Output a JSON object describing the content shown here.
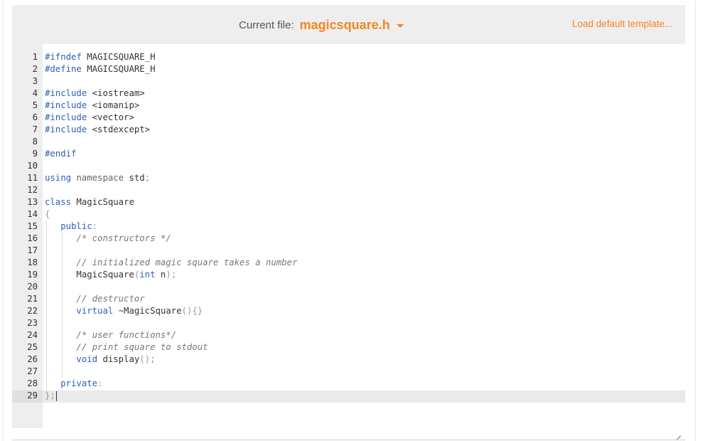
{
  "header": {
    "current_file_label": "Current file:",
    "current_file": "magicsquare.h",
    "load_template_label": "Load default template...",
    "accent_color": "#f5861f"
  },
  "editor": {
    "active_line": 29,
    "lines": [
      {
        "n": "1",
        "tokens": [
          {
            "t": "#ifndef",
            "c": "pre"
          },
          {
            "t": " MAGICSQUARE_H",
            "c": "id"
          }
        ]
      },
      {
        "n": "2",
        "tokens": [
          {
            "t": "#define",
            "c": "pre"
          },
          {
            "t": " MAGICSQUARE_H",
            "c": "id"
          }
        ]
      },
      {
        "n": "3",
        "tokens": []
      },
      {
        "n": "4",
        "tokens": [
          {
            "t": "#include",
            "c": "pre"
          },
          {
            "t": " <iostream>",
            "c": "id"
          }
        ]
      },
      {
        "n": "5",
        "tokens": [
          {
            "t": "#include",
            "c": "pre"
          },
          {
            "t": " <iomanip>",
            "c": "id"
          }
        ]
      },
      {
        "n": "6",
        "tokens": [
          {
            "t": "#include",
            "c": "pre"
          },
          {
            "t": " <vector>",
            "c": "id"
          }
        ]
      },
      {
        "n": "7",
        "tokens": [
          {
            "t": "#include",
            "c": "pre"
          },
          {
            "t": " <stdexcept>",
            "c": "id"
          }
        ]
      },
      {
        "n": "8",
        "tokens": []
      },
      {
        "n": "9",
        "tokens": [
          {
            "t": "#endif",
            "c": "pre"
          }
        ]
      },
      {
        "n": "10",
        "tokens": []
      },
      {
        "n": "11",
        "tokens": [
          {
            "t": "using",
            "c": "kw"
          },
          {
            "t": " ",
            "c": "id"
          },
          {
            "t": "namespace",
            "c": "ns"
          },
          {
            "t": " std",
            "c": "id"
          },
          {
            "t": ";",
            "c": "pn"
          }
        ]
      },
      {
        "n": "12",
        "tokens": []
      },
      {
        "n": "13",
        "tokens": [
          {
            "t": "class",
            "c": "kw"
          },
          {
            "t": " MagicSquare",
            "c": "id"
          }
        ]
      },
      {
        "n": "14",
        "tokens": [
          {
            "t": "{",
            "c": "pn"
          }
        ]
      },
      {
        "n": "15",
        "indent": 1,
        "tokens": [
          {
            "t": "   ",
            "c": "id"
          },
          {
            "t": "public",
            "c": "kw"
          },
          {
            "t": ":",
            "c": "pn"
          }
        ]
      },
      {
        "n": "16",
        "indent": 2,
        "tokens": [
          {
            "t": "      ",
            "c": "id"
          },
          {
            "t": "/* constructors */",
            "c": "cm"
          }
        ]
      },
      {
        "n": "17",
        "indent": 2,
        "tokens": []
      },
      {
        "n": "18",
        "indent": 2,
        "tokens": [
          {
            "t": "      ",
            "c": "id"
          },
          {
            "t": "// initialized magic square takes a number",
            "c": "cm"
          }
        ]
      },
      {
        "n": "19",
        "indent": 2,
        "tokens": [
          {
            "t": "      MagicSquare",
            "c": "id"
          },
          {
            "t": "(",
            "c": "pn"
          },
          {
            "t": "int",
            "c": "ty"
          },
          {
            "t": " n",
            "c": "id"
          },
          {
            "t": ");",
            "c": "pn"
          }
        ]
      },
      {
        "n": "20",
        "indent": 2,
        "tokens": []
      },
      {
        "n": "21",
        "indent": 2,
        "tokens": [
          {
            "t": "      ",
            "c": "id"
          },
          {
            "t": "// destructor",
            "c": "cm"
          }
        ]
      },
      {
        "n": "22",
        "indent": 2,
        "tokens": [
          {
            "t": "      ",
            "c": "id"
          },
          {
            "t": "virtual",
            "c": "kw"
          },
          {
            "t": " ~MagicSquare",
            "c": "id"
          },
          {
            "t": "(){}",
            "c": "pn"
          }
        ]
      },
      {
        "n": "23",
        "indent": 2,
        "tokens": []
      },
      {
        "n": "24",
        "indent": 2,
        "tokens": [
          {
            "t": "      ",
            "c": "id"
          },
          {
            "t": "/* user functions*/",
            "c": "cm"
          }
        ]
      },
      {
        "n": "25",
        "indent": 2,
        "tokens": [
          {
            "t": "      ",
            "c": "id"
          },
          {
            "t": "// print square to stdout",
            "c": "cm"
          }
        ]
      },
      {
        "n": "26",
        "indent": 2,
        "tokens": [
          {
            "t": "      ",
            "c": "id"
          },
          {
            "t": "void",
            "c": "ty"
          },
          {
            "t": " display",
            "c": "id"
          },
          {
            "t": "();",
            "c": "pn"
          }
        ]
      },
      {
        "n": "27",
        "indent": 2,
        "tokens": []
      },
      {
        "n": "28",
        "indent": 1,
        "tokens": [
          {
            "t": "   ",
            "c": "id"
          },
          {
            "t": "private",
            "c": "kw"
          },
          {
            "t": ":",
            "c": "pn"
          }
        ]
      },
      {
        "n": "29",
        "tokens": [
          {
            "t": "};",
            "c": "pn"
          }
        ],
        "cursor": true
      }
    ]
  }
}
